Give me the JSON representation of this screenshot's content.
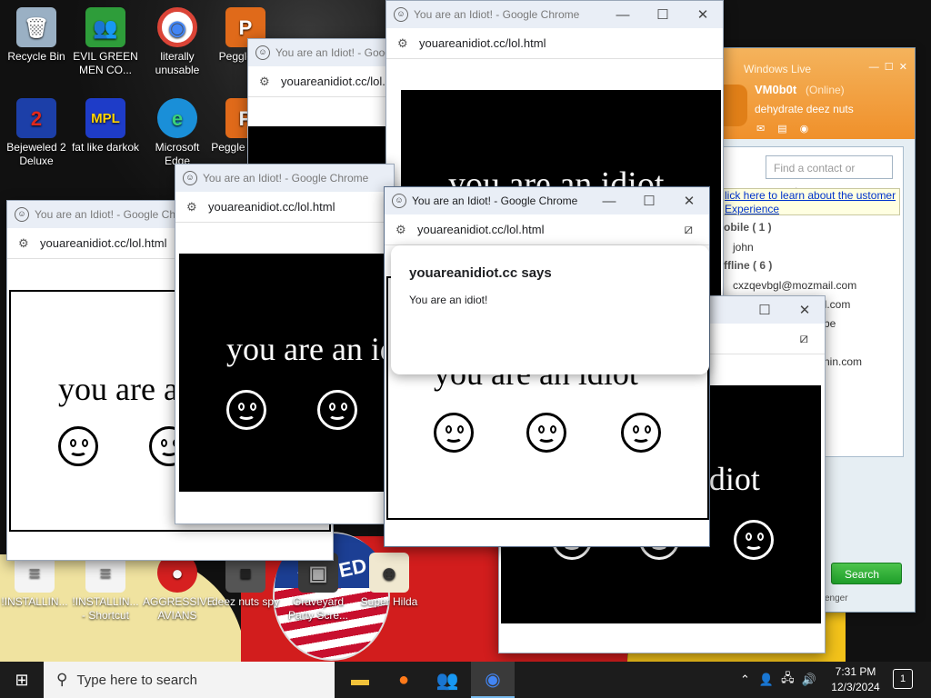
{
  "desktop": {
    "icons": [
      {
        "label": "Recycle Bin",
        "glyph": "🗑"
      },
      {
        "label": "EVIL GREEN MEN CO...",
        "glyph": "👥"
      },
      {
        "label": "literally unusable",
        "glyph": "◉"
      },
      {
        "label": "Peggle Del",
        "glyph": "P"
      },
      {
        "label": "Bejeweled 2 Deluxe",
        "glyph": "2"
      },
      {
        "label": "fat like darkok",
        "glyph": "MPL"
      },
      {
        "label": "Microsoft Edge",
        "glyph": "e"
      },
      {
        "label": "Peggle of War",
        "glyph": "P"
      },
      {
        "label": "!INSTALLIN...",
        "glyph": "≡"
      },
      {
        "label": "!INSTALLIN... - Shortcut",
        "glyph": "≡"
      },
      {
        "label": "AGGRESSIVE AVIANS",
        "glyph": "●"
      },
      {
        "label": "deez nuts spy",
        "glyph": "■"
      },
      {
        "label": "Graveyard Party Scre...",
        "glyph": "▣"
      },
      {
        "label": "Super Hilda",
        "glyph": "☻"
      }
    ],
    "badge_text": "VOTED"
  },
  "chrome_windows": [
    {
      "title": "You are an Idiot! - Google Chrome",
      "url": "youareanidiot.cc/lol.html",
      "page_text": "you are an idiot"
    },
    {
      "title": "You are an Idiot! - Google Chrome",
      "url": "youareanidiot.cc/lol.html",
      "page_text": "you are an idiot"
    },
    {
      "title": "You are an Idiot! - Google Chrome",
      "url": "youareanidiot.cc/lol.html",
      "page_text": "you are an idiot"
    },
    {
      "title": "You are an Idiot! - Google Chrome",
      "url": "youareanidiot.cc/lol.html",
      "page_text": "you are an idiot"
    },
    {
      "title": "You are an Idiot! - Google Chrome",
      "url": "youareanidiot.cc/lol.html",
      "page_text": "you are an idiot"
    },
    {
      "title": "You are an Idiot! - Google Chrome",
      "url": "youareanidiot.cc/lol.html",
      "page_text": "you are an idiot"
    }
  ],
  "window_controls": {
    "minimize": "—",
    "maximize": "☐",
    "close": "✕"
  },
  "dialog": {
    "title": "youareanidiot.cc says",
    "message": "You are an idiot!"
  },
  "messenger": {
    "app_title": "Windows Live",
    "user_name": "VM0b0t",
    "status": "(Online)",
    "personal_message": "dehydrate deez nuts",
    "search_placeholder": "Find a contact or number",
    "banner": "lick here to learn about the ustomer Experience",
    "groups": [
      {
        "label": "obile ( 1 )",
        "contacts": [
          "john"
        ]
      },
      {
        "label": "ffline ( 6 )",
        "contacts": [
          "cxzqevbgl@mozmail.com",
          "il.com",
          "be",
          "nin.com"
        ]
      }
    ],
    "search_button": "Search",
    "footer": "senger"
  },
  "taskbar": {
    "search_placeholder": "Type here to search",
    "time": "7:31 PM",
    "date": "12/3/2024",
    "notification_count": "1"
  },
  "colors": {
    "chrome_titlebar": "#e9eef6",
    "messenger_orange": "#f0902a",
    "search_green": "#1f9e2a",
    "taskbar": "#1c1c1c"
  }
}
